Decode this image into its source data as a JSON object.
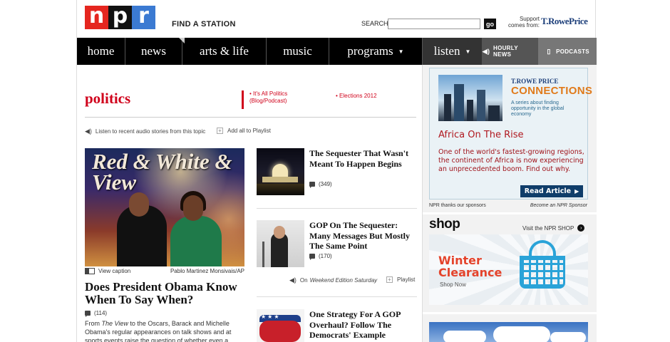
{
  "header": {
    "logo_letters": [
      "n",
      "p",
      "r"
    ],
    "logo_colors": [
      "#e5261f",
      "#111111",
      "#3b7ad2"
    ],
    "find_station": "FIND A STATION",
    "search_label": "SEARCH",
    "search_placeholder": "",
    "search_go": "go",
    "support_text": "Support comes from:",
    "sponsor": "T.RowePrice"
  },
  "nav": {
    "items": [
      "home",
      "news",
      "arts & life",
      "music",
      "programs",
      "listen"
    ],
    "hourly_news": "HOURLY NEWS",
    "podcasts": "PODCASTS"
  },
  "section": {
    "title": "politics",
    "related": [
      "It's All Politics (Blog/Podcast)",
      "Elections 2012"
    ],
    "listen_recent": "Listen to recent audio stories from this topic",
    "add_all": "Add all to Playlist"
  },
  "lead_story": {
    "image_text": "Red & White & View",
    "view_caption": "View caption",
    "credit": "Pablo Martinez Monsivais/AP",
    "headline": "Does President Obama Know When To Say When?",
    "comments": "(114)",
    "teaser_prefix": "From ",
    "teaser_italic": "The View",
    "teaser_rest": " to the Oscars, Barack and Michelle Obama's regular appearances on talk shows and at sports events raise the question of whether even a"
  },
  "stories": [
    {
      "headline": "The Sequester That Wasn't Meant To Happen Begins",
      "comments": "(349)"
    },
    {
      "headline": "GOP On The Sequester: Many Messages But Mostly The Same Point",
      "comments": "(170)"
    },
    {
      "headline": "One Strategy For A GOP Overhaul? Follow The Democrats' Example",
      "comments": ""
    }
  ],
  "story_audio": {
    "on_prefix": "On ",
    "program": "Weekend Edition Saturday",
    "playlist": "Playlist"
  },
  "sponsor_ad": {
    "brand": "T.ROWE PRICE",
    "campaign": "CONNECTIONS",
    "subtitle": "A series about finding opportunity in the global economy",
    "headline": "Africa On The Rise",
    "body": "One of the world's fastest-growing regions, the continent of Africa is now experiencing an unprecedented boom. Find out why.",
    "button": "Read Article",
    "thanks": "NPR thanks our sponsors",
    "become": "Become an NPR Sponsor"
  },
  "shop": {
    "title": "shop",
    "visit": "Visit the NPR SHOP",
    "headline_line1": "Winter",
    "headline_line2": "Clearance",
    "cta": "Shop Now"
  },
  "colors": {
    "brand_red": "#d0021b",
    "nav_bg": "#000000",
    "ad_blue": "#0f3d6a",
    "shop_red": "#e4432b",
    "basket_blue": "#2aa3d8"
  }
}
